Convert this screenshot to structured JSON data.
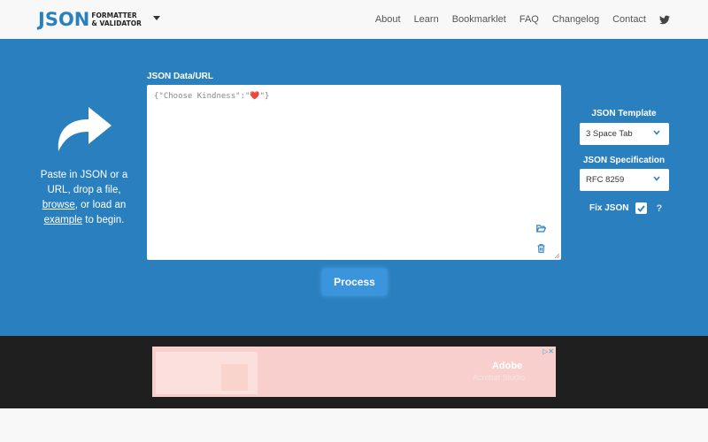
{
  "header": {
    "logo_main": "JSON",
    "logo_line1": "FORMATTER",
    "logo_line2": "& VALIDATOR",
    "nav": [
      "About",
      "Learn",
      "Bookmarklet",
      "FAQ",
      "Changelog",
      "Contact"
    ]
  },
  "hint": {
    "line_a": "Paste in JSON or a URL, drop a file,",
    "browse": "browse",
    "line_b": ", or load an",
    "example": "example",
    "line_c": " to begin."
  },
  "editor": {
    "label": "JSON Data/URL",
    "text_start": "{\"Choose Kindness\":\"",
    "heart": "❤️",
    "text_end": "\"}"
  },
  "process_label": "Process",
  "settings": {
    "template_label": "JSON Template",
    "template_value": "3 Space Tab",
    "spec_label": "JSON Specification",
    "spec_value": "RFC 8259",
    "fix_label": "Fix JSON",
    "fix_checked": true,
    "help": "?"
  },
  "ad": {
    "brand": "Adobe",
    "sub": "Acrobat Studio"
  },
  "colors": {
    "accent": "#2a80be",
    "button": "#3b95dc",
    "dark_band": "#1f1f1f"
  }
}
